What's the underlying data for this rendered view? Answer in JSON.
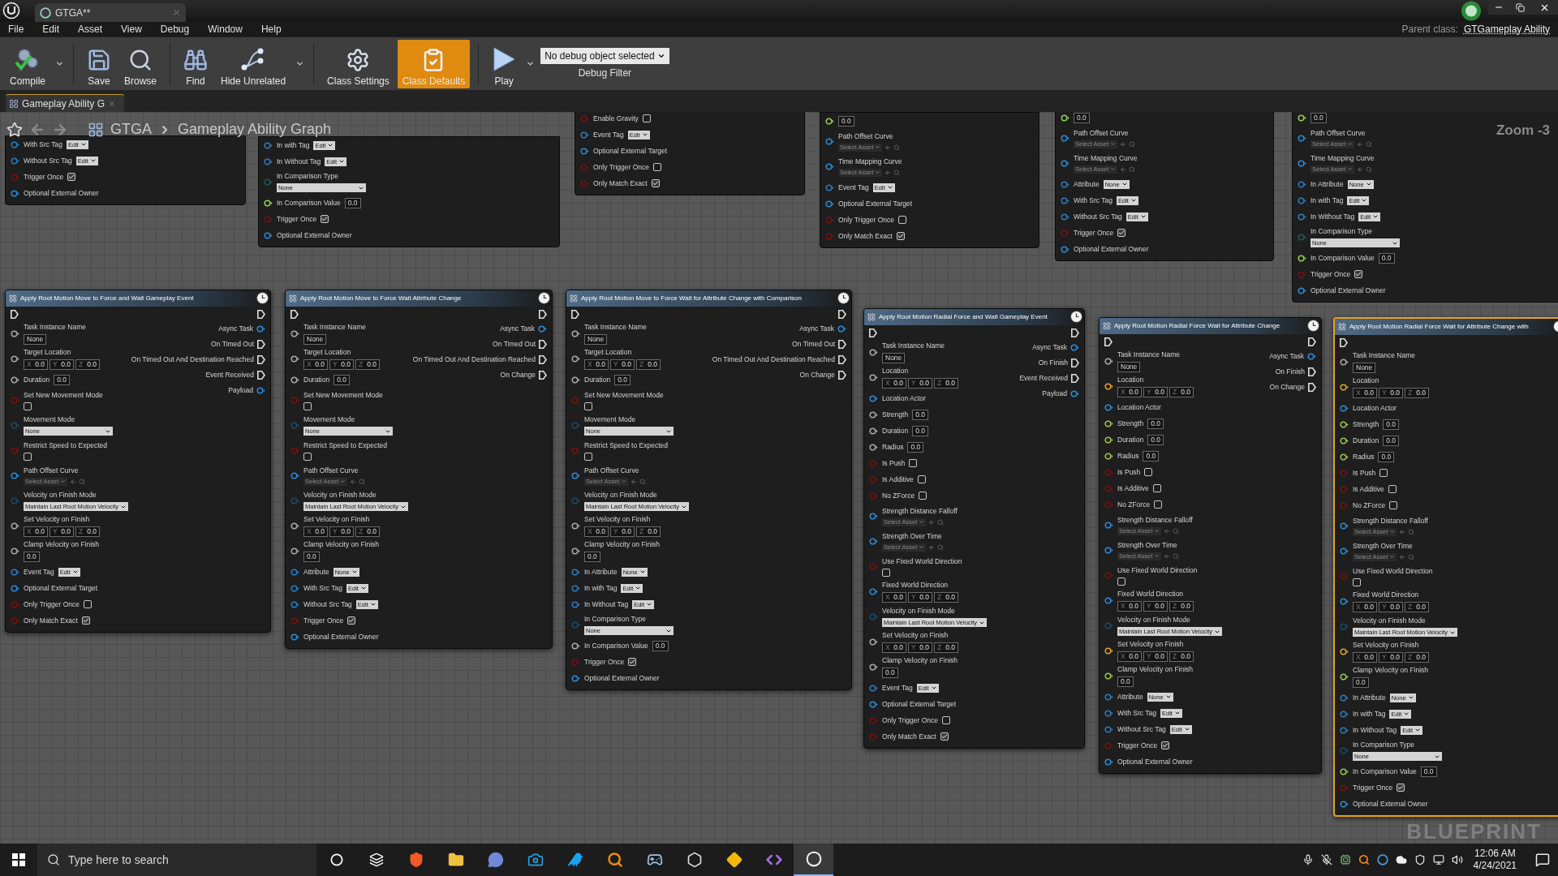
{
  "window": {
    "tab": "GTGA**",
    "parent_class_label": "Parent class:",
    "parent_class": "GTGameplay Ability"
  },
  "menu": [
    "File",
    "Edit",
    "Asset",
    "View",
    "Debug",
    "Window",
    "Help"
  ],
  "toolbar": [
    {
      "label": "Compile",
      "menu": true,
      "selected": false
    },
    {
      "label": "Save",
      "menu": false,
      "selected": false
    },
    {
      "label": "Browse",
      "menu": false,
      "selected": false
    },
    {
      "label": "Find",
      "menu": false,
      "selected": false
    },
    {
      "label": "Hide Unrelated",
      "menu": true,
      "selected": false
    },
    {
      "label": "Class Settings",
      "menu": false,
      "selected": false
    },
    {
      "label": "Class Defaults",
      "menu": false,
      "selected": true
    },
    {
      "label": "Play",
      "menu": true,
      "selected": false
    }
  ],
  "debug_filter": {
    "value": "No debug object selected",
    "label": "Debug Filter"
  },
  "document_tab": {
    "label": "Gameplay Ability G"
  },
  "breadcrumb": [
    "GTGA",
    "Gameplay Ability Graph"
  ],
  "zoom_label": "Zoom -3",
  "watermark": "BLUEPRINT",
  "partial_nodes": [
    {
      "inputs": [
        {
          "kind": "tag",
          "label": "With Src Tag",
          "value": "Edit",
          "color": "#2b7ac0"
        },
        {
          "kind": "tag",
          "label": "Without Src Tag",
          "value": "Edit",
          "color": "#2b7ac0"
        },
        {
          "kind": "check",
          "label": "Trigger Once",
          "checked": true,
          "color": "#7a1010"
        },
        {
          "kind": "plain",
          "label": "Optional External Owner",
          "color": "#2b8ad6"
        }
      ]
    },
    {
      "inputs": [
        {
          "kind": "tag",
          "label": "In with Tag",
          "value": "Edit",
          "color": "#2b7ac0"
        },
        {
          "kind": "tag",
          "label": "In Without Tag",
          "value": "Edit",
          "color": "#2b7ac0"
        },
        {
          "kind": "combo",
          "label": "In Comparison Type",
          "value": "None",
          "color": "#1c5a55"
        },
        {
          "kind": "number",
          "label": "In Comparison Value",
          "value": "0.0",
          "color": "#8fd04a"
        },
        {
          "kind": "check",
          "label": "Trigger Once",
          "checked": true,
          "color": "#7a1010"
        },
        {
          "kind": "plain",
          "label": "Optional External Owner",
          "color": "#2b8ad6"
        }
      ]
    },
    {
      "inputs": [
        {
          "kind": "check",
          "label": "Enable Gravity",
          "checked": false,
          "color": "#7a1010"
        },
        {
          "kind": "tag",
          "label": "Event Tag",
          "value": "Edit",
          "color": "#2b7ac0"
        },
        {
          "kind": "plain",
          "label": "Optional External Target",
          "color": "#2b8ad6"
        },
        {
          "kind": "check",
          "label": "Only Trigger Once",
          "checked": false,
          "color": "#7a1010"
        },
        {
          "kind": "check",
          "label": "Only Match Exact",
          "checked": true,
          "color": "#7a1010"
        }
      ]
    },
    {
      "inputs": [
        {
          "kind": "box",
          "value": "0.0",
          "color": "#8fd04a"
        },
        {
          "kind": "asset",
          "label": "Path Offset Curve",
          "value": "Select Asset",
          "color": "#2b8ad6"
        },
        {
          "kind": "asset",
          "label": "Time Mapping Curve",
          "value": "Select Asset",
          "color": "#2b8ad6"
        },
        {
          "kind": "tag",
          "label": "Event Tag",
          "value": "Edit",
          "color": "#2b7ac0"
        },
        {
          "kind": "plain",
          "label": "Optional External Target",
          "color": "#2b8ad6"
        },
        {
          "kind": "check",
          "label": "Only Trigger Once",
          "checked": false,
          "color": "#7a1010"
        },
        {
          "kind": "check",
          "label": "Only Match Exact",
          "checked": true,
          "color": "#7a1010"
        }
      ]
    },
    {
      "inputs": [
        {
          "kind": "box",
          "value": "0.0",
          "color": "#8fd04a"
        },
        {
          "kind": "asset",
          "label": "Path Offset Curve",
          "value": "Select Asset",
          "color": "#2b8ad6"
        },
        {
          "kind": "asset",
          "label": "Time Mapping Curve",
          "value": "Select Asset",
          "color": "#2b8ad6"
        },
        {
          "kind": "tag",
          "label": "Attribute",
          "value": "None",
          "color": "#2b7ac0"
        },
        {
          "kind": "tag",
          "label": "With Src Tag",
          "value": "Edit",
          "color": "#2b7ac0"
        },
        {
          "kind": "tag",
          "label": "Without Src Tag",
          "value": "Edit",
          "color": "#2b7ac0"
        },
        {
          "kind": "check",
          "label": "Trigger Once",
          "checked": true,
          "color": "#7a1010"
        },
        {
          "kind": "plain",
          "label": "Optional External Owner",
          "color": "#2b8ad6"
        }
      ]
    },
    {
      "inputs": [
        {
          "kind": "box",
          "value": "0.0",
          "color": "#8fd04a"
        },
        {
          "kind": "asset",
          "label": "Path Offset Curve",
          "value": "Select Asset",
          "color": "#2b8ad6"
        },
        {
          "kind": "asset",
          "label": "Time Mapping Curve",
          "value": "Select Asset",
          "color": "#2b8ad6"
        },
        {
          "kind": "tag",
          "label": "In Attribute",
          "value": "None",
          "color": "#2b7ac0"
        },
        {
          "kind": "tag",
          "label": "In with Tag",
          "value": "Edit",
          "color": "#2b7ac0"
        },
        {
          "kind": "tag",
          "label": "In Without Tag",
          "value": "Edit",
          "color": "#2b7ac0"
        },
        {
          "kind": "combo",
          "label": "In Comparison Type",
          "value": "None",
          "color": "#1c5a55"
        },
        {
          "kind": "number",
          "label": "In Comparison Value",
          "value": "0.0",
          "color": "#8fd04a"
        },
        {
          "kind": "check",
          "label": "Trigger Once",
          "checked": true,
          "color": "#7a1010"
        },
        {
          "kind": "plain",
          "label": "Optional External Owner",
          "color": "#2b8ad6"
        }
      ]
    }
  ],
  "nodes": [
    {
      "title": "Apply Root Motion Move to Force and Wait Gameplay Event",
      "selected": false,
      "inputs": [
        {
          "kind": "name",
          "label": "Task Instance Name",
          "value": "None",
          "color": "#a8a8a8"
        },
        {
          "kind": "vector",
          "label": "Target Location",
          "color": "#a8a8a8",
          "values": [
            {
              "axis": "X",
              "value": "0.0"
            },
            {
              "axis": "Y",
              "value": "0.0"
            },
            {
              "axis": "Z",
              "value": "0.0"
            }
          ]
        },
        {
          "kind": "number",
          "label": "Duration",
          "value": "0.0",
          "color": "#a8a8a8"
        },
        {
          "kind": "checkbelow",
          "label": "Set New Movement Mode",
          "checked": false,
          "color": "#7a1010"
        },
        {
          "kind": "combo",
          "label": "Movement Mode",
          "value": "None",
          "color": "#1c4a66"
        },
        {
          "kind": "checkbelow",
          "label": "Restrict Speed to Expected",
          "checked": false,
          "color": "#7a1010"
        },
        {
          "kind": "asset",
          "label": "Path Offset Curve",
          "value": "Select Asset",
          "color": "#2b8ad6"
        },
        {
          "kind": "combo",
          "label": "Velocity on Finish Mode",
          "value": "Maintain Last Root Motion Velocity",
          "color": "#1c4a66"
        },
        {
          "kind": "vector",
          "label": "Set Velocity on Finish",
          "color": "#a8a8a8",
          "values": [
            {
              "axis": "X",
              "value": "0.0"
            },
            {
              "axis": "Y",
              "value": "0.0"
            },
            {
              "axis": "Z",
              "value": "0.0"
            }
          ]
        },
        {
          "kind": "numberbelow",
          "label": "Clamp Velocity on Finish",
          "value": "0.0",
          "color": "#a8a8a8"
        },
        {
          "kind": "tag",
          "label": "Event Tag",
          "value": "Edit",
          "color": "#2b7ac0"
        },
        {
          "kind": "plain",
          "label": "Optional External Target",
          "color": "#2b8ad6"
        },
        {
          "kind": "check",
          "label": "Only Trigger Once",
          "checked": false,
          "color": "#7a1010"
        },
        {
          "kind": "check",
          "label": "Only Match Exact",
          "checked": true,
          "color": "#7a1010"
        }
      ],
      "outputs": [
        {
          "kind": "data",
          "label": "Async Task",
          "color": "#2b8ad6"
        },
        {
          "kind": "exec",
          "label": "On Timed Out",
          "color": "#e0e0e0"
        },
        {
          "kind": "exec",
          "label": "On Timed Out And Destination Reached",
          "color": "#e0e0e0"
        },
        {
          "kind": "exec",
          "label": "Event Received",
          "color": "#e0e0e0"
        },
        {
          "kind": "data",
          "label": "Payload",
          "color": "#2b8ad6"
        }
      ]
    },
    {
      "title": "Apply Root Motion Move to Force Wait Attribute Change",
      "selected": false,
      "inputs": [
        {
          "kind": "name",
          "label": "Task Instance Name",
          "value": "None",
          "color": "#a8a8a8"
        },
        {
          "kind": "vector",
          "label": "Target Location",
          "color": "#a8a8a8",
          "values": [
            {
              "axis": "X",
              "value": "0.0"
            },
            {
              "axis": "Y",
              "value": "0.0"
            },
            {
              "axis": "Z",
              "value": "0.0"
            }
          ]
        },
        {
          "kind": "number",
          "label": "Duration",
          "value": "0.0",
          "color": "#a8a8a8"
        },
        {
          "kind": "checkbelow",
          "label": "Set New Movement Mode",
          "checked": false,
          "color": "#7a1010"
        },
        {
          "kind": "combo",
          "label": "Movement Mode",
          "value": "None",
          "color": "#1c4a66"
        },
        {
          "kind": "checkbelow",
          "label": "Restrict Speed to Expected",
          "checked": false,
          "color": "#7a1010"
        },
        {
          "kind": "asset",
          "label": "Path Offset Curve",
          "value": "Select Asset",
          "color": "#2b8ad6"
        },
        {
          "kind": "combo",
          "label": "Velocity on Finish Mode",
          "value": "Maintain Last Root Motion Velocity",
          "color": "#1c4a66"
        },
        {
          "kind": "vector",
          "label": "Set Velocity on Finish",
          "color": "#a8a8a8",
          "values": [
            {
              "axis": "X",
              "value": "0.0"
            },
            {
              "axis": "Y",
              "value": "0.0"
            },
            {
              "axis": "Z",
              "value": "0.0"
            }
          ]
        },
        {
          "kind": "numberbelow",
          "label": "Clamp Velocity on Finish",
          "value": "0.0",
          "color": "#a8a8a8"
        },
        {
          "kind": "tag",
          "label": "Attribute",
          "value": "None",
          "color": "#2b7ac0"
        },
        {
          "kind": "tag",
          "label": "With Src Tag",
          "value": "Edit",
          "color": "#2b7ac0"
        },
        {
          "kind": "tag",
          "label": "Without Src Tag",
          "value": "Edit",
          "color": "#2b7ac0"
        },
        {
          "kind": "check",
          "label": "Trigger Once",
          "checked": true,
          "color": "#7a1010"
        },
        {
          "kind": "plain",
          "label": "Optional External Owner",
          "color": "#2b8ad6"
        }
      ],
      "outputs": [
        {
          "kind": "data",
          "label": "Async Task",
          "color": "#2b8ad6"
        },
        {
          "kind": "exec",
          "label": "On Timed Out",
          "color": "#e0e0e0"
        },
        {
          "kind": "exec",
          "label": "On Timed Out And Destination Reached",
          "color": "#e0e0e0"
        },
        {
          "kind": "exec",
          "label": "On Change",
          "color": "#e0e0e0"
        }
      ]
    },
    {
      "title": "Apply Root Motion Move to Force Wait for Attribute Change with Comparison",
      "selected": false,
      "inputs": [
        {
          "kind": "name",
          "label": "Task Instance Name",
          "value": "None",
          "color": "#a8a8a8"
        },
        {
          "kind": "vector",
          "label": "Target Location",
          "color": "#a8a8a8",
          "values": [
            {
              "axis": "X",
              "value": "0.0"
            },
            {
              "axis": "Y",
              "value": "0.0"
            },
            {
              "axis": "Z",
              "value": "0.0"
            }
          ]
        },
        {
          "kind": "number",
          "label": "Duration",
          "value": "0.0",
          "color": "#a8a8a8"
        },
        {
          "kind": "checkbelow",
          "label": "Set New Movement Mode",
          "checked": false,
          "color": "#7a1010"
        },
        {
          "kind": "combo",
          "label": "Movement Mode",
          "value": "None",
          "color": "#1c4a66"
        },
        {
          "kind": "checkbelow",
          "label": "Restrict Speed to Expected",
          "checked": false,
          "color": "#7a1010"
        },
        {
          "kind": "asset",
          "label": "Path Offset Curve",
          "value": "Select Asset",
          "color": "#2b8ad6"
        },
        {
          "kind": "combo",
          "label": "Velocity on Finish Mode",
          "value": "Maintain Last Root Motion Velocity",
          "color": "#1c4a66"
        },
        {
          "kind": "vector",
          "label": "Set Velocity on Finish",
          "color": "#a8a8a8",
          "values": [
            {
              "axis": "X",
              "value": "0.0"
            },
            {
              "axis": "Y",
              "value": "0.0"
            },
            {
              "axis": "Z",
              "value": "0.0"
            }
          ]
        },
        {
          "kind": "numberbelow",
          "label": "Clamp Velocity on Finish",
          "value": "0.0",
          "color": "#a8a8a8"
        },
        {
          "kind": "tag",
          "label": "In Attribute",
          "value": "None",
          "color": "#2b7ac0"
        },
        {
          "kind": "tag",
          "label": "In with Tag",
          "value": "Edit",
          "color": "#2b7ac0"
        },
        {
          "kind": "tag",
          "label": "In Without Tag",
          "value": "Edit",
          "color": "#2b7ac0"
        },
        {
          "kind": "combo",
          "label": "In Comparison Type",
          "value": "None",
          "color": "#1c4a66"
        },
        {
          "kind": "number",
          "label": "In Comparison Value",
          "value": "0.0",
          "color": "#a8a8a8"
        },
        {
          "kind": "check",
          "label": "Trigger Once",
          "checked": true,
          "color": "#7a1010"
        },
        {
          "kind": "plain",
          "label": "Optional External Owner",
          "color": "#2b8ad6"
        }
      ],
      "outputs": [
        {
          "kind": "data",
          "label": "Async Task",
          "color": "#2b8ad6"
        },
        {
          "kind": "exec",
          "label": "On Timed Out",
          "color": "#e0e0e0"
        },
        {
          "kind": "exec",
          "label": "On Timed Out And Destination Reached",
          "color": "#e0e0e0"
        },
        {
          "kind": "exec",
          "label": "On Change",
          "color": "#e0e0e0"
        }
      ]
    },
    {
      "title": "Apply Root Motion Radial Force and Wait Gameplay Event",
      "selected": false,
      "inputs": [
        {
          "kind": "name",
          "label": "Task Instance Name",
          "value": "None",
          "color": "#a8a8a8"
        },
        {
          "kind": "vector",
          "label": "Location",
          "color": "#a8a8a8",
          "values": [
            {
              "axis": "X",
              "value": "0.0"
            },
            {
              "axis": "Y",
              "value": "0.0"
            },
            {
              "axis": "Z",
              "value": "0.0"
            }
          ]
        },
        {
          "kind": "plain",
          "label": "Location Actor",
          "color": "#2b8ad6"
        },
        {
          "kind": "number",
          "label": "Strength",
          "value": "0.0",
          "color": "#a8a8a8"
        },
        {
          "kind": "number",
          "label": "Duration",
          "value": "0.0",
          "color": "#a8a8a8"
        },
        {
          "kind": "number",
          "label": "Radius",
          "value": "0.0",
          "color": "#a8a8a8"
        },
        {
          "kind": "check",
          "label": "Is Push",
          "checked": false,
          "color": "#7a1010"
        },
        {
          "kind": "check",
          "label": "Is Additive",
          "checked": false,
          "color": "#7a1010"
        },
        {
          "kind": "check",
          "label": "No ZForce",
          "checked": false,
          "color": "#7a1010"
        },
        {
          "kind": "asset",
          "label": "Strength Distance Falloff",
          "value": "Select Asset",
          "color": "#2b8ad6"
        },
        {
          "kind": "asset",
          "label": "Strength Over Time",
          "value": "Select Asset",
          "color": "#2b8ad6"
        },
        {
          "kind": "checkbelow",
          "label": "Use Fixed World Direction",
          "checked": false,
          "color": "#7a1010"
        },
        {
          "kind": "vector",
          "label": "Fixed World Direction",
          "color": "#2b8ad6",
          "values": [
            {
              "axis": "X",
              "value": "0.0"
            },
            {
              "axis": "Y",
              "value": "0.0"
            },
            {
              "axis": "Z",
              "value": "0.0"
            }
          ]
        },
        {
          "kind": "combo",
          "label": "Velocity on Finish Mode",
          "value": "Maintain Last Root Motion Velocity",
          "color": "#1c4a66"
        },
        {
          "kind": "vector",
          "label": "Set Velocity on Finish",
          "color": "#a8a8a8",
          "values": [
            {
              "axis": "X",
              "value": "0.0"
            },
            {
              "axis": "Y",
              "value": "0.0"
            },
            {
              "axis": "Z",
              "value": "0.0"
            }
          ]
        },
        {
          "kind": "numberbelow",
          "label": "Clamp Velocity on Finish",
          "value": "0.0",
          "color": "#a8a8a8"
        },
        {
          "kind": "tag",
          "label": "Event Tag",
          "value": "Edit",
          "color": "#2b7ac0"
        },
        {
          "kind": "plain",
          "label": "Optional External Target",
          "color": "#2b8ad6"
        },
        {
          "kind": "check",
          "label": "Only Trigger Once",
          "checked": false,
          "color": "#7a1010"
        },
        {
          "kind": "check",
          "label": "Only Match Exact",
          "checked": true,
          "color": "#7a1010"
        }
      ],
      "outputs": [
        {
          "kind": "data",
          "label": "Async Task",
          "color": "#2b8ad6"
        },
        {
          "kind": "exec",
          "label": "On Finish",
          "color": "#e0e0e0"
        },
        {
          "kind": "exec",
          "label": "Event Received",
          "color": "#e0e0e0"
        },
        {
          "kind": "data",
          "label": "Payload",
          "color": "#2b8ad6"
        }
      ]
    },
    {
      "title": "Apply Root Motion Radial Force Wait for Attribute Change",
      "selected": false,
      "inputs": [
        {
          "kind": "name",
          "label": "Task Instance Name",
          "value": "None",
          "color": "#a8a8a8"
        },
        {
          "kind": "vector",
          "label": "Location",
          "color": "#e6a020",
          "values": [
            {
              "axis": "X",
              "value": "0.0"
            },
            {
              "axis": "Y",
              "value": "0.0"
            },
            {
              "axis": "Z",
              "value": "0.0"
            }
          ]
        },
        {
          "kind": "plain",
          "label": "Location Actor",
          "color": "#2b8ad6"
        },
        {
          "kind": "number",
          "label": "Strength",
          "value": "0.0",
          "color": "#9bc44a"
        },
        {
          "kind": "number",
          "label": "Duration",
          "value": "0.0",
          "color": "#9bc44a"
        },
        {
          "kind": "number",
          "label": "Radius",
          "value": "0.0",
          "color": "#9bc44a"
        },
        {
          "kind": "check",
          "label": "Is Push",
          "checked": false,
          "color": "#7a1010"
        },
        {
          "kind": "check",
          "label": "Is Additive",
          "checked": false,
          "color": "#7a1010"
        },
        {
          "kind": "check",
          "label": "No ZForce",
          "checked": false,
          "color": "#7a1010"
        },
        {
          "kind": "asset",
          "label": "Strength Distance Falloff",
          "value": "Select Asset",
          "color": "#2b8ad6"
        },
        {
          "kind": "asset",
          "label": "Strength Over Time",
          "value": "Select Asset",
          "color": "#2b8ad6"
        },
        {
          "kind": "checkbelow",
          "label": "Use Fixed World Direction",
          "checked": false,
          "color": "#7a1010"
        },
        {
          "kind": "vector",
          "label": "Fixed World Direction",
          "color": "#2b8ad6",
          "values": [
            {
              "axis": "X",
              "value": "0.0"
            },
            {
              "axis": "Y",
              "value": "0.0"
            },
            {
              "axis": "Z",
              "value": "0.0"
            }
          ]
        },
        {
          "kind": "combo",
          "label": "Velocity on Finish Mode",
          "value": "Maintain Last Root Motion Velocity",
          "color": "#1c4a66"
        },
        {
          "kind": "vector",
          "label": "Set Velocity on Finish",
          "color": "#e6a020",
          "values": [
            {
              "axis": "X",
              "value": "0.0"
            },
            {
              "axis": "Y",
              "value": "0.0"
            },
            {
              "axis": "Z",
              "value": "0.0"
            }
          ]
        },
        {
          "kind": "numberbelow",
          "label": "Clamp Velocity on Finish",
          "value": "0.0",
          "color": "#9bc44a"
        },
        {
          "kind": "tag",
          "label": "Attribute",
          "value": "None",
          "color": "#2b7ac0"
        },
        {
          "kind": "tag",
          "label": "With Src Tag",
          "value": "Edit",
          "color": "#2b7ac0"
        },
        {
          "kind": "tag",
          "label": "Without Src Tag",
          "value": "Edit",
          "color": "#2b7ac0"
        },
        {
          "kind": "check",
          "label": "Trigger Once",
          "checked": true,
          "color": "#7a1010"
        },
        {
          "kind": "plain",
          "label": "Optional External Owner",
          "color": "#2b8ad6"
        }
      ],
      "outputs": [
        {
          "kind": "data",
          "label": "Async Task",
          "color": "#2b8ad6"
        },
        {
          "kind": "exec",
          "label": "On Finish",
          "color": "#e0e0e0"
        },
        {
          "kind": "exec",
          "label": "On Change",
          "color": "#e0e0e0"
        }
      ]
    },
    {
      "title": "Apply Root Motion Radial Force Wait for Attribute Change with",
      "selected": true,
      "inputs": [
        {
          "kind": "name",
          "label": "Task Instance Name",
          "value": "None",
          "color": "#a8a8a8"
        },
        {
          "kind": "vector",
          "label": "Location",
          "color": "#e6a020",
          "values": [
            {
              "axis": "X",
              "value": "0.0"
            },
            {
              "axis": "Y",
              "value": "0.0"
            },
            {
              "axis": "Z",
              "value": "0.0"
            }
          ]
        },
        {
          "kind": "plain",
          "label": "Location Actor",
          "color": "#2b8ad6"
        },
        {
          "kind": "number",
          "label": "Strength",
          "value": "0.0",
          "color": "#9bc44a"
        },
        {
          "kind": "number",
          "label": "Duration",
          "value": "0.0",
          "color": "#9bc44a"
        },
        {
          "kind": "number",
          "label": "Radius",
          "value": "0.0",
          "color": "#9bc44a"
        },
        {
          "kind": "check",
          "label": "Is Push",
          "checked": false,
          "color": "#7a1010"
        },
        {
          "kind": "check",
          "label": "Is Additive",
          "checked": false,
          "color": "#7a1010"
        },
        {
          "kind": "check",
          "label": "No ZForce",
          "checked": false,
          "color": "#7a1010"
        },
        {
          "kind": "asset",
          "label": "Strength Distance Falloff",
          "value": "Select Asset",
          "color": "#2b8ad6"
        },
        {
          "kind": "asset",
          "label": "Strength Over Time",
          "value": "Select Asset",
          "color": "#2b8ad6"
        },
        {
          "kind": "checkbelow",
          "label": "Use Fixed World Direction",
          "checked": false,
          "color": "#7a1010"
        },
        {
          "kind": "vector",
          "label": "Fixed World Direction",
          "color": "#2b8ad6",
          "values": [
            {
              "axis": "X",
              "value": "0.0"
            },
            {
              "axis": "Y",
              "value": "0.0"
            },
            {
              "axis": "Z",
              "value": "0.0"
            }
          ]
        },
        {
          "kind": "combo",
          "label": "Velocity on Finish Mode",
          "value": "Maintain Last Root Motion Velocity",
          "color": "#1c4a66"
        },
        {
          "kind": "vector",
          "label": "Set Velocity on Finish",
          "color": "#e6a020",
          "values": [
            {
              "axis": "X",
              "value": "0.0"
            },
            {
              "axis": "Y",
              "value": "0.0"
            },
            {
              "axis": "Z",
              "value": "0.0"
            }
          ]
        },
        {
          "kind": "numberbelow",
          "label": "Clamp Velocity on Finish",
          "value": "0.0",
          "color": "#9bc44a"
        },
        {
          "kind": "tag",
          "label": "In Attribute",
          "value": "None",
          "color": "#2b7ac0"
        },
        {
          "kind": "tag",
          "label": "In with Tag",
          "value": "Edit",
          "color": "#2b7ac0"
        },
        {
          "kind": "tag",
          "label": "In Without Tag",
          "value": "Edit",
          "color": "#2b7ac0"
        },
        {
          "kind": "combo",
          "label": "In Comparison Type",
          "value": "None",
          "color": "#1c4a66"
        },
        {
          "kind": "number",
          "label": "In Comparison Value",
          "value": "0.0",
          "color": "#9bc44a"
        },
        {
          "kind": "check",
          "label": "Trigger Once",
          "checked": true,
          "color": "#7a1010"
        },
        {
          "kind": "plain",
          "label": "Optional External Owner",
          "color": "#2b8ad6"
        }
      ]
    }
  ],
  "taskbar": {
    "search_placeholder": "Type here to search",
    "time": "12:06 AM",
    "date": "4/24/2021"
  }
}
